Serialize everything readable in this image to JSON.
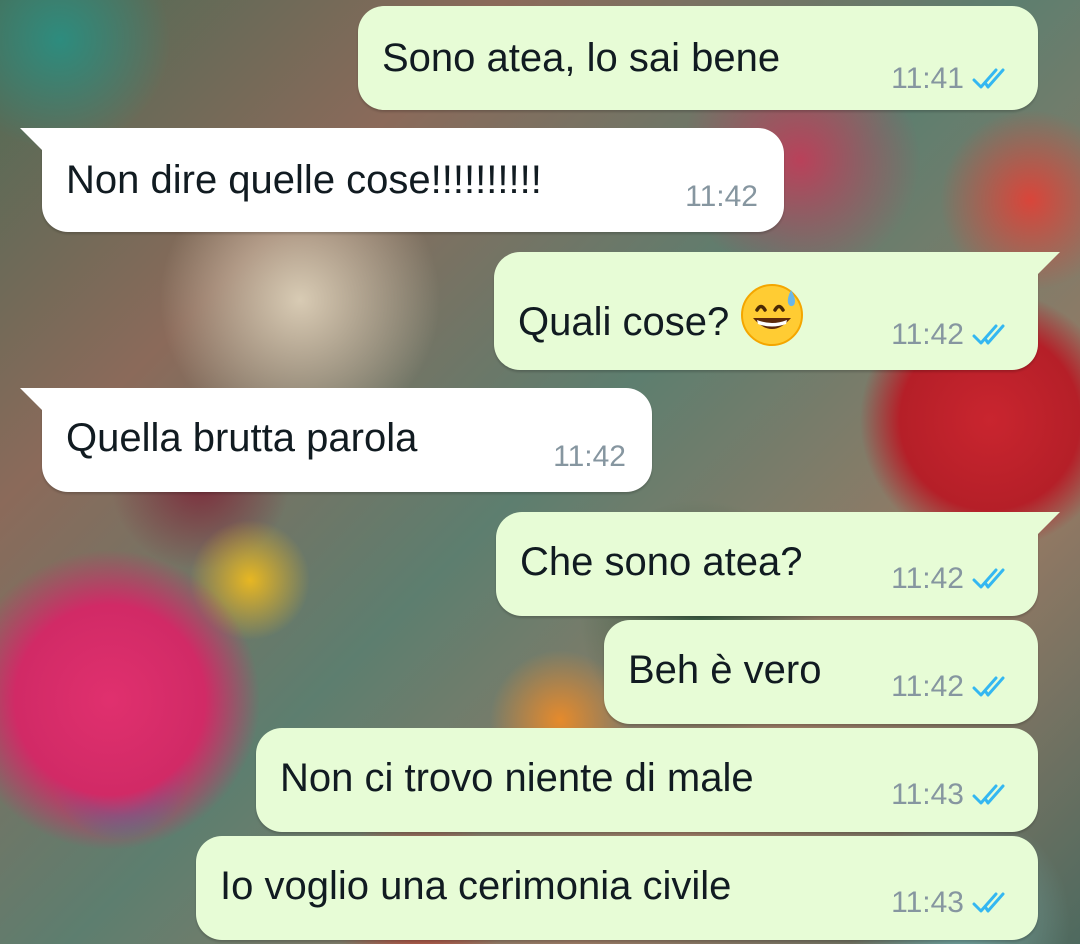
{
  "colors": {
    "outgoing_bubble": "#e7fcd6",
    "incoming_bubble": "#ffffff",
    "timestamp": "#8696a0",
    "read_ticks": "#34b7f1",
    "text": "#111b21"
  },
  "messages": [
    {
      "direction": "out",
      "text": "Sono atea, lo sai bene",
      "time": "11:41",
      "status": "read"
    },
    {
      "direction": "in",
      "text": "Non dire quelle cose!!!!!!!!!!",
      "time": "11:42"
    },
    {
      "direction": "out",
      "text": "Quali cose?",
      "emoji": "grinning-face-with-sweat",
      "time": "11:42",
      "status": "read"
    },
    {
      "direction": "in",
      "text": "Quella brutta parola",
      "time": "11:42"
    },
    {
      "direction": "out",
      "text": "Che sono atea?",
      "time": "11:42",
      "status": "read"
    },
    {
      "direction": "out",
      "text": "Beh è vero",
      "time": "11:42",
      "status": "read"
    },
    {
      "direction": "out",
      "text": "Non ci trovo niente di male",
      "time": "11:43",
      "status": "read"
    },
    {
      "direction": "out",
      "text": "Io voglio una cerimonia civile",
      "time": "11:43",
      "status": "read"
    }
  ]
}
